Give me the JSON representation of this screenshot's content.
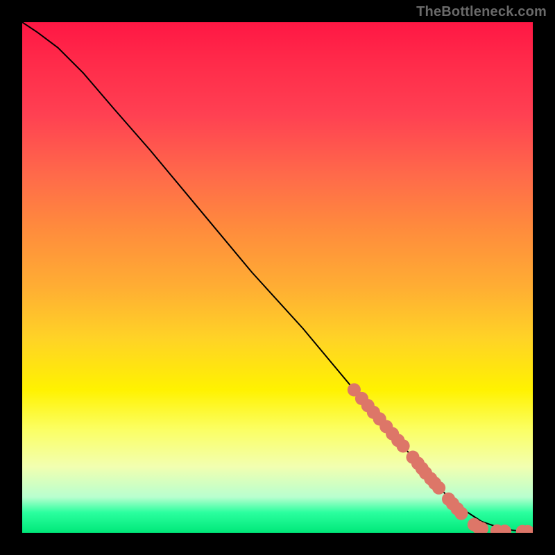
{
  "watermark": "TheBottleneck.com",
  "chart_data": {
    "type": "line",
    "title": "",
    "xlabel": "",
    "ylabel": "",
    "xlim": [
      0,
      100
    ],
    "ylim": [
      0,
      100
    ],
    "grid": false,
    "curve": {
      "x": [
        0,
        3,
        7,
        12,
        18,
        25,
        35,
        45,
        55,
        65,
        72,
        78,
        82,
        85,
        88,
        90,
        92,
        94,
        96,
        98,
        100
      ],
      "y": [
        100,
        98,
        95,
        90,
        83,
        75,
        63,
        51,
        40,
        28,
        20,
        13,
        8.5,
        5.5,
        3.5,
        2.2,
        1.5,
        0.9,
        0.5,
        0.3,
        0.2
      ]
    },
    "points": {
      "color": "#dd7668",
      "radius": 1.3,
      "xy": [
        [
          65,
          28
        ],
        [
          66.5,
          26.3
        ],
        [
          67.7,
          24.9
        ],
        [
          68.8,
          23.6
        ],
        [
          70,
          22.3
        ],
        [
          71.3,
          20.8
        ],
        [
          72.5,
          19.4
        ],
        [
          73.6,
          18.1
        ],
        [
          74.6,
          17
        ],
        [
          76.5,
          14.8
        ],
        [
          77.5,
          13.6
        ],
        [
          78.3,
          12.6
        ],
        [
          79,
          11.7
        ],
        [
          80,
          10.6
        ],
        [
          80.8,
          9.7
        ],
        [
          81.6,
          8.8
        ],
        [
          83.5,
          6.6
        ],
        [
          84.3,
          5.7
        ],
        [
          85.2,
          4.7
        ],
        [
          86,
          3.8
        ],
        [
          88.5,
          1.6
        ],
        [
          89.3,
          1.1
        ],
        [
          90,
          0.8
        ],
        [
          93,
          0.35
        ],
        [
          94.5,
          0.3
        ],
        [
          98,
          0.25
        ],
        [
          99,
          0.23
        ]
      ]
    }
  }
}
